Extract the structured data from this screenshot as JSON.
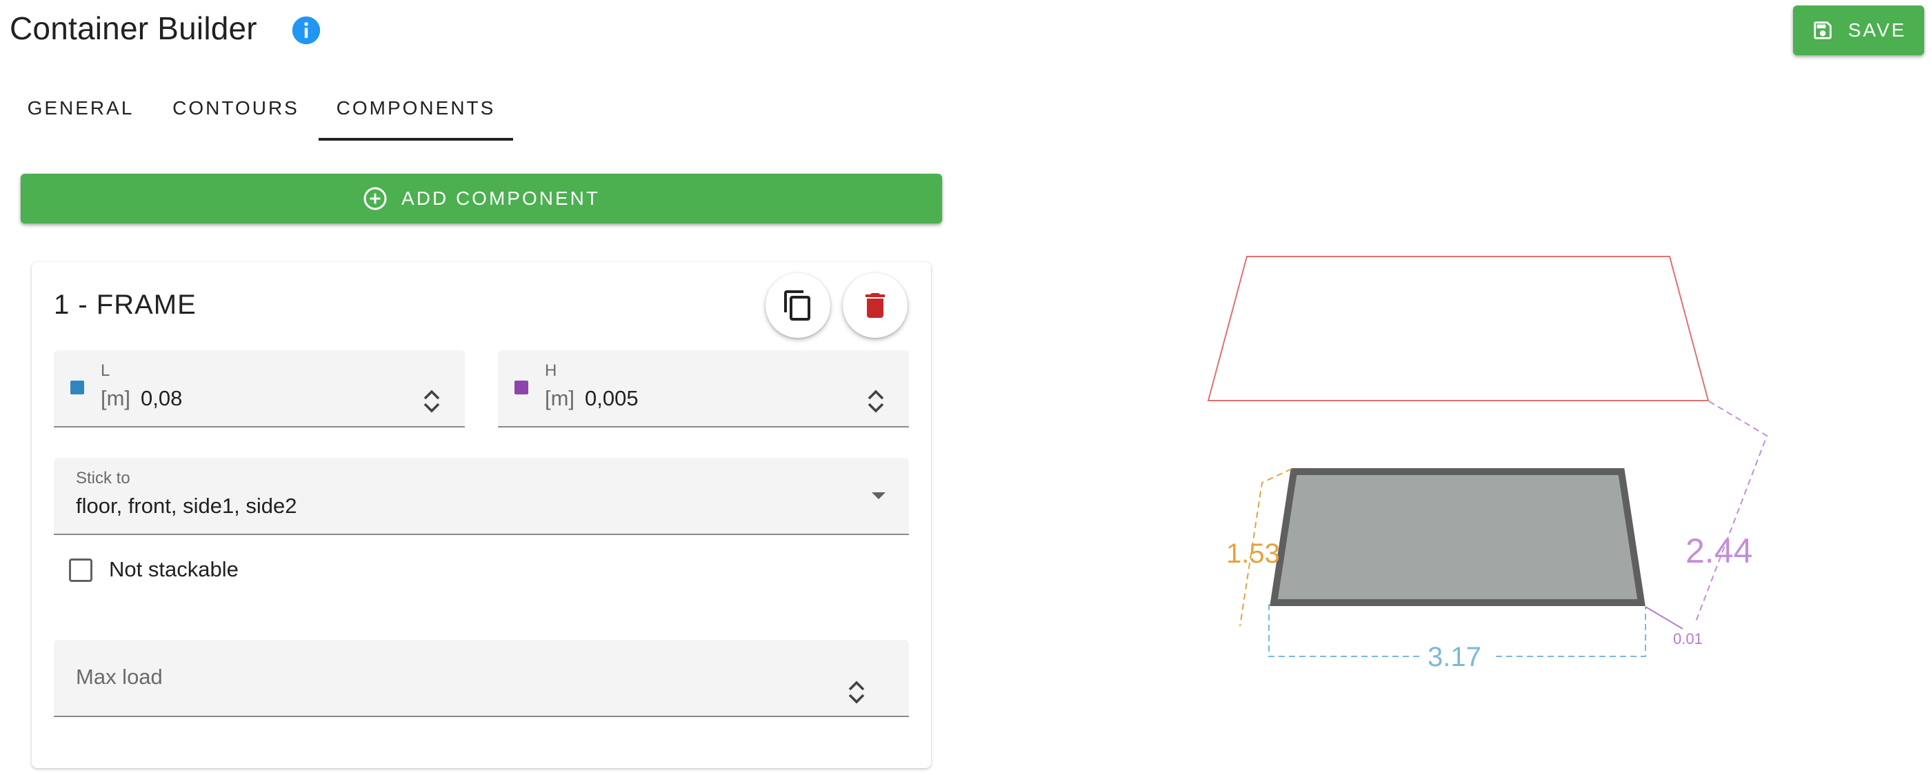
{
  "header": {
    "title": "Container Builder",
    "save_label": "SAVE"
  },
  "tabs": [
    {
      "label": "GENERAL",
      "active": false
    },
    {
      "label": "CONTOURS",
      "active": false
    },
    {
      "label": "COMPONENTS",
      "active": true
    }
  ],
  "add_component_label": "ADD COMPONENT",
  "component": {
    "title": "1 - FRAME",
    "length": {
      "label": "L",
      "unit": "[m]",
      "value": "0,08",
      "color": "#2e86c1"
    },
    "height": {
      "label": "H",
      "unit": "[m]",
      "value": "0,005",
      "color": "#8e44ad"
    },
    "stick_to": {
      "label": "Stick to",
      "value": "floor, front, side1, side2"
    },
    "not_stackable": {
      "label": "Not stackable",
      "checked": false
    },
    "max_load": {
      "label": "Max load",
      "value": ""
    }
  },
  "diagram": {
    "height_label": "1.53",
    "width_label": "3.17",
    "depth_label": "2.44",
    "thickness_label": "0.01",
    "colors": {
      "height": "#e6a23c",
      "width": "#7ab8d9",
      "depth": "#c38fd6",
      "thickness": "#b57bd0",
      "outline": "#e07070",
      "frame": "#5f5f5f",
      "fill": "#a2a6a4"
    }
  },
  "colors": {
    "accent_green": "#4caf50",
    "info_blue": "#2196f3",
    "delete_red": "#c62828"
  }
}
